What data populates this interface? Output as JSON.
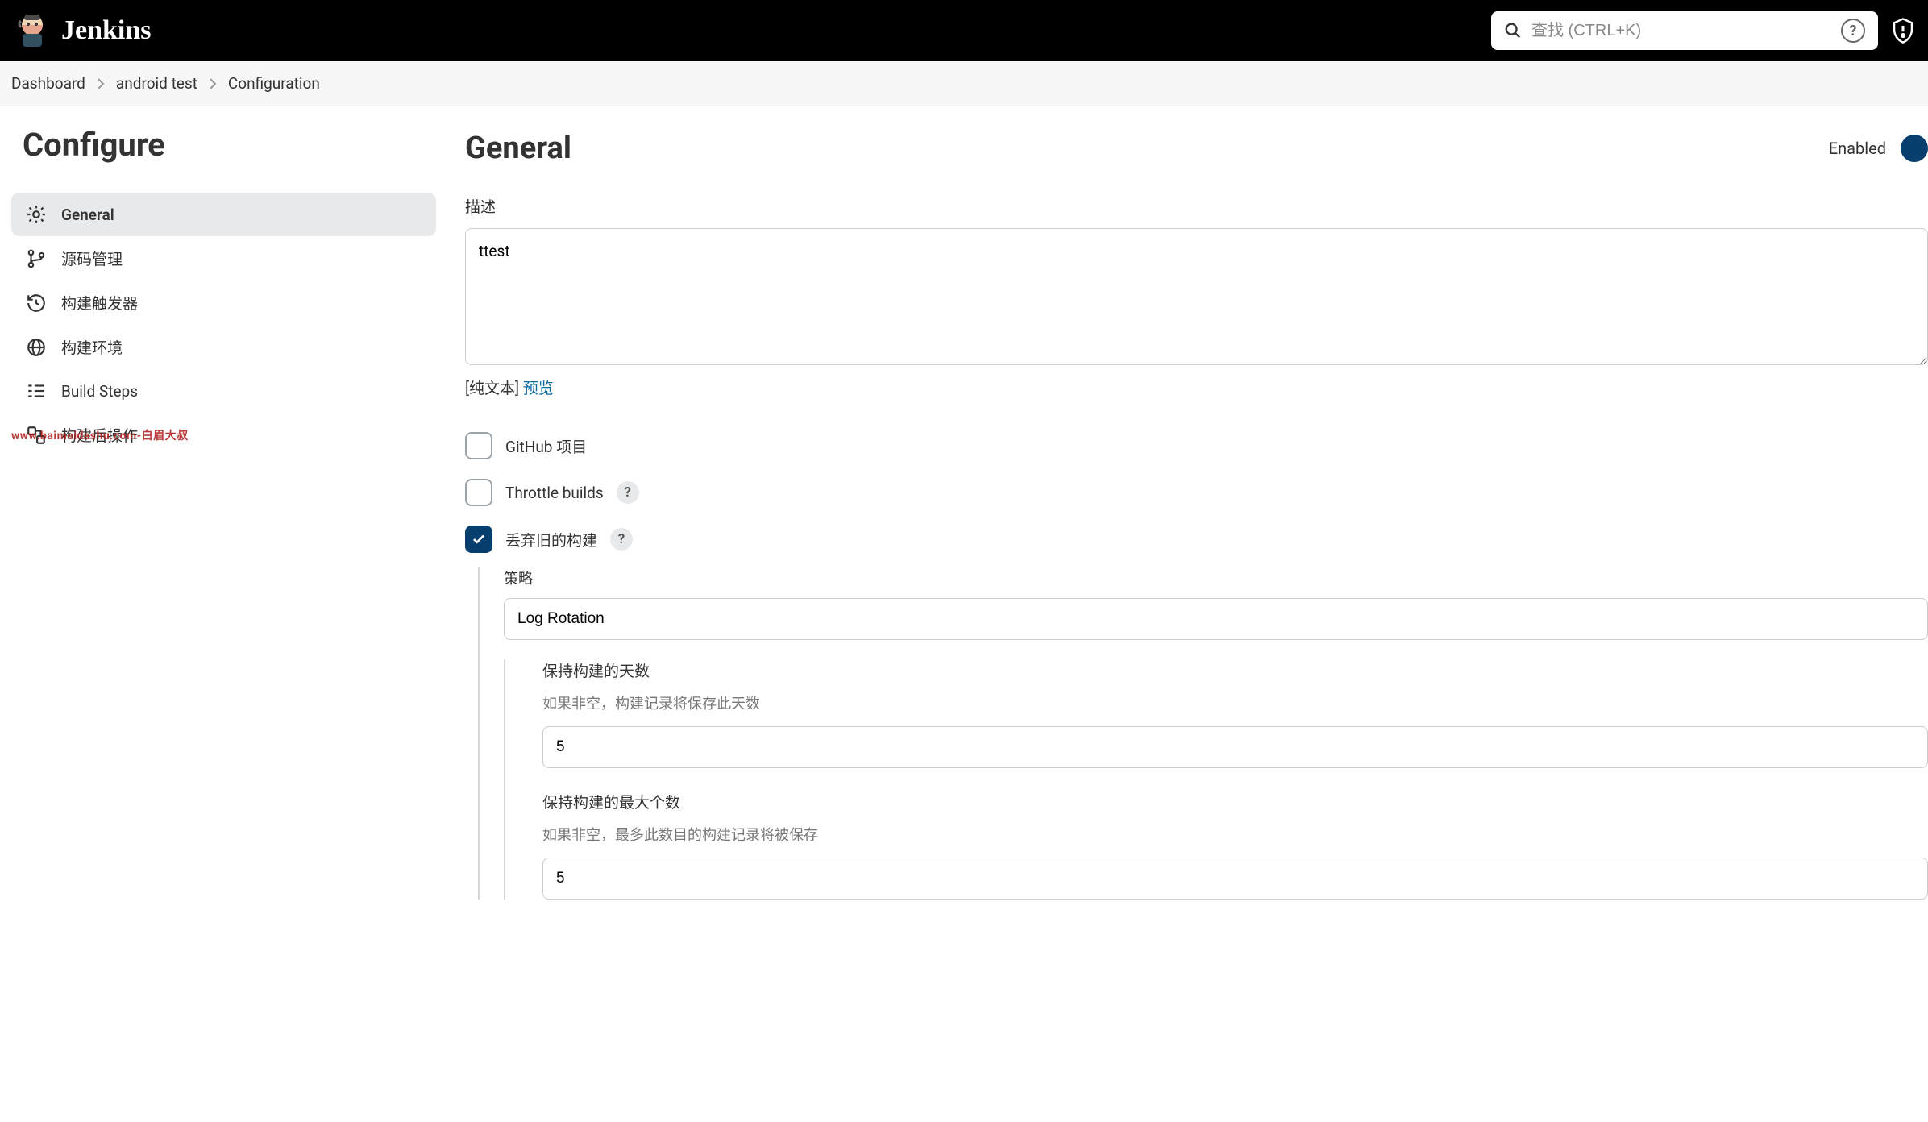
{
  "header": {
    "brand": "Jenkins",
    "search_placeholder": "查找 (CTRL+K)"
  },
  "breadcrumb": {
    "items": [
      "Dashboard",
      "android test",
      "Configuration"
    ]
  },
  "sidebar": {
    "title": "Configure",
    "items": [
      {
        "label": "General"
      },
      {
        "label": "源码管理"
      },
      {
        "label": "构建触发器"
      },
      {
        "label": "构建环境"
      },
      {
        "label": "Build Steps"
      },
      {
        "label": "构建后操作"
      }
    ],
    "watermark": "www.baimeidashu.com-白眉大叔"
  },
  "content": {
    "section_title": "General",
    "enabled_label": "Enabled",
    "description": {
      "label": "描述",
      "value": "ttest",
      "format_prefix": "[纯文本]",
      "preview_link": "预览"
    },
    "checkboxes": {
      "github_project": "GitHub 项目",
      "throttle_builds": "Throttle builds",
      "discard_old": "丢弃旧的构建"
    },
    "discard": {
      "strategy_label": "策略",
      "strategy_value": "Log Rotation",
      "days_label": "保持构建的天数",
      "days_hint": "如果非空，构建记录将保存此天数",
      "days_value": "5",
      "max_label": "保持构建的最大个数",
      "max_hint": "如果非空，最多此数目的构建记录将被保存",
      "max_value": "5"
    }
  }
}
